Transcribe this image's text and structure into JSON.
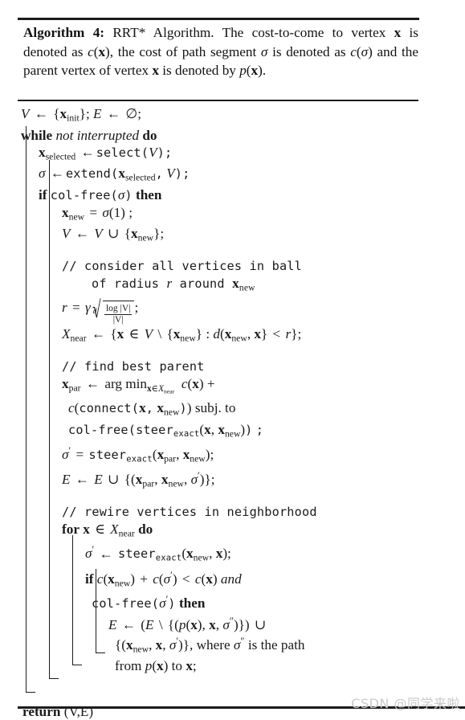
{
  "caption": {
    "label": "Algorithm 4:",
    "text": " RRT* Algorithm. The cost-to-come to vertex x is denoted as c(x), the cost of path segment σ is denoted as c(σ) and the parent vertex of vertex x is denoted by p(x)."
  },
  "lines": {
    "init": "V ← {x_init}; E ← ∅;",
    "while": "while not interrupted do",
    "while_kw": "while",
    "while_cond": "not interrupted",
    "while_do": "do",
    "select": "x_selected ← select(V);",
    "select_fn": "select",
    "extend": "σ ← extend(x_selected, V);",
    "extend_fn": "extend",
    "if_colfree_kw": "if",
    "if_colfree_fn": "col-free",
    "if_colfree_then": "then",
    "xnew_assign": "x_new = σ(1) ;",
    "v_union": "V ← V ∪ {x_new};",
    "comment_ball_1": "// consider all vertices in ball",
    "comment_ball_2": "of radius r around x_new",
    "radius": "r = γ d√(log|V| / |V|);",
    "radius_gamma": "γ",
    "radius_degree": "d",
    "radius_num": "log |V|",
    "radius_den": "|V|",
    "xnear": "X_near ← {x ∈ V \\ {x_new} : d(x_new, x} < r};",
    "comment_parent": "// find best parent",
    "xpar_1": "x_par ← arg min_{x∈X_near}  c(x) +",
    "xpar_2": "c(connect(x, x_new)) subj. to",
    "xpar_2_fn": "connect",
    "xpar_2_tail": "subj. to",
    "xpar_3_fn1": "col-free",
    "xpar_3_fn2": "steer",
    "xpar_3_sub": "exact",
    "sigma_prime": "σ' = steer_exact(x_par, x_new);",
    "e_union": "E ← E ∪ {(x_par, x_new, σ')};",
    "comment_rewire": "// rewire vertices in neighborhood",
    "for_kw": "for",
    "for_cond": "x ∈ X_near",
    "for_do": "do",
    "steer_line": "σ' ← steer_exact(x_new, x);",
    "if_cost_kw": "if",
    "if_cost_body": "c(x_new) + c(σ') < c(x)",
    "if_cost_and": "and",
    "if_colfree2_fn": "col-free",
    "if_colfree2_then": "then",
    "rewire_1": "E ← (E \\ {(p(x), x, σ'')}) ∪",
    "rewire_2": "{(x_new, x, σ')}, where σ'' is the path",
    "rewire_2_tail": "is the path",
    "rewire_3": "from p(x) to x;",
    "return_kw": "return",
    "return_val": "(V,E)"
  },
  "watermark": "CSDN @同学来啦",
  "colors": {
    "text": "#1a1a1a",
    "rule": "#1c1c1c",
    "watermark": "#c9c9c9",
    "background": "#ffffff"
  }
}
